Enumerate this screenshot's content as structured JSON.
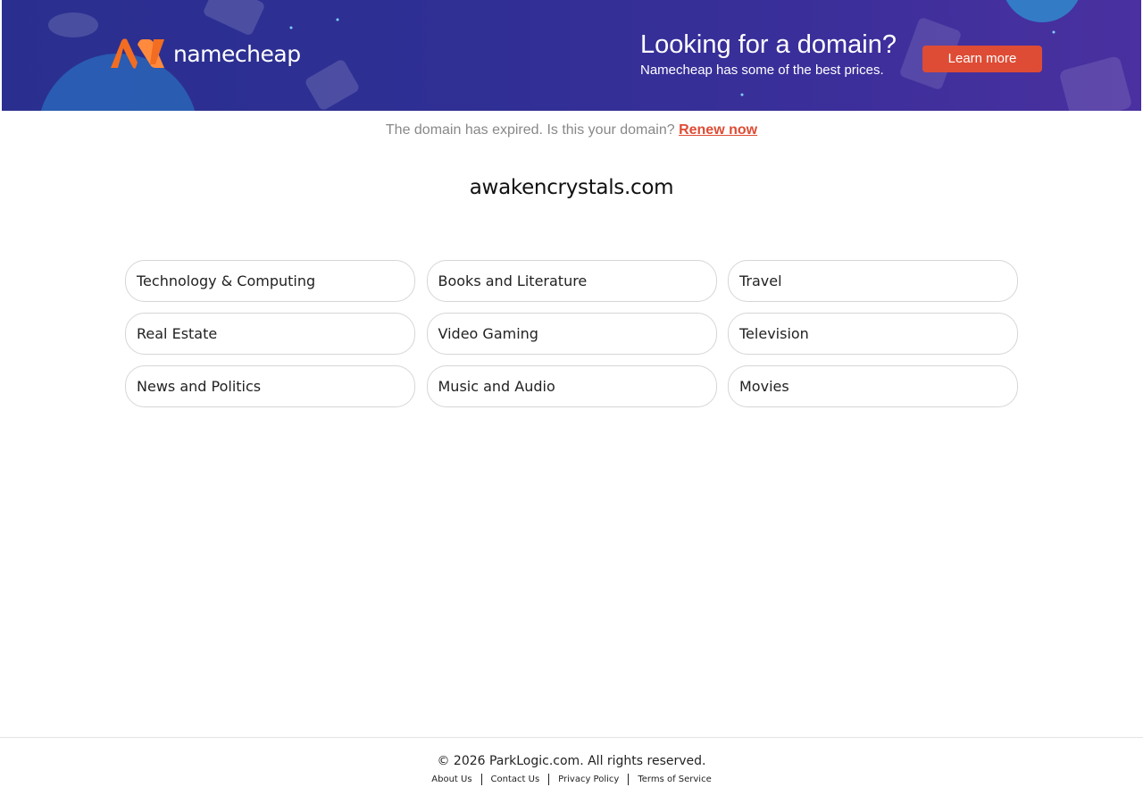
{
  "banner": {
    "brand": "namecheap",
    "headline": "Looking for a domain?",
    "subheadline": "Namecheap has some of the best prices.",
    "cta_label": "Learn more",
    "colors": {
      "background": "#2f2f94",
      "accent": "#de4c35",
      "logo_orange": "#f26d21"
    }
  },
  "notice": {
    "text": "The domain has expired. Is this your domain?",
    "link_label": "Renew now"
  },
  "domain_name": "awakencrystals.com",
  "categories": [
    "Technology & Computing",
    "Books and Literature",
    "Travel",
    "Real Estate",
    "Video Gaming",
    "Television",
    "News and Politics",
    "Music and Audio",
    "Movies"
  ],
  "footer": {
    "copyright": "© 2026 ParkLogic.com. All rights reserved.",
    "links": [
      "About Us",
      "Contact Us",
      "Privacy Policy",
      "Terms of Service"
    ]
  }
}
